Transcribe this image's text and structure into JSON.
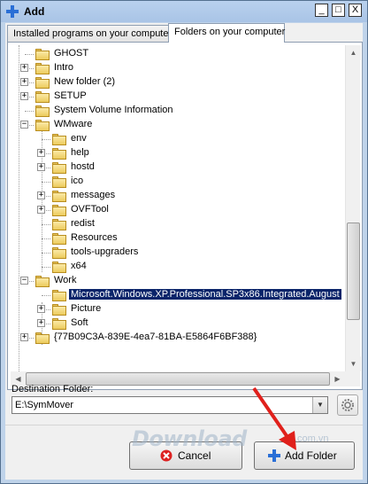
{
  "window": {
    "title": "Add"
  },
  "title_buttons": {
    "minimize": "_",
    "maximize": "□",
    "close": "X"
  },
  "tabs": [
    {
      "label": "Installed programs on your computer",
      "active": false
    },
    {
      "label": "Folders on your computer",
      "active": true
    }
  ],
  "tree": {
    "items": [
      {
        "label": "GHOST",
        "expander": ""
      },
      {
        "label": "Intro",
        "expander": "+"
      },
      {
        "label": "New folder (2)",
        "expander": "+"
      },
      {
        "label": "SETUP",
        "expander": "+"
      },
      {
        "label": "System Volume Information",
        "expander": ""
      },
      {
        "label": "WMware",
        "expander": "−"
      },
      {
        "label": "env",
        "expander": ""
      },
      {
        "label": "help",
        "expander": "+"
      },
      {
        "label": "hostd",
        "expander": "+"
      },
      {
        "label": "ico",
        "expander": ""
      },
      {
        "label": "messages",
        "expander": "+"
      },
      {
        "label": "OVFTool",
        "expander": "+"
      },
      {
        "label": "redist",
        "expander": ""
      },
      {
        "label": "Resources",
        "expander": ""
      },
      {
        "label": "tools-upgraders",
        "expander": ""
      },
      {
        "label": "x64",
        "expander": ""
      },
      {
        "label": "Work",
        "expander": "−"
      },
      {
        "label": "Microsoft.Windows.XP.Professional.SP3x86.Integrated.August",
        "expander": "",
        "selected": true
      },
      {
        "label": "Picture",
        "expander": "+"
      },
      {
        "label": "Soft",
        "expander": "+"
      },
      {
        "label": "{77B09C3A-839E-4ea7-81BA-E5864F6BF388}",
        "expander": "+"
      }
    ]
  },
  "destination": {
    "label": "Destination Folder:",
    "value": "E:\\SymMover"
  },
  "buttons": {
    "cancel": "Cancel",
    "add_folder": "Add Folder"
  },
  "watermark": {
    "text": "Download",
    "suffix": ".com.vn"
  },
  "colors": {
    "selection": "#0a246a",
    "arrow": "#e0201b",
    "folder": "#eccb5d"
  }
}
